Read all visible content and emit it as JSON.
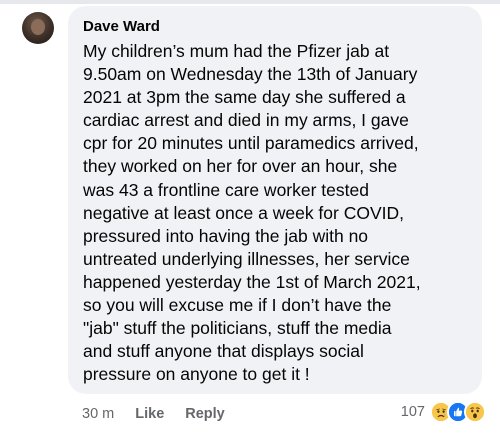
{
  "comment": {
    "author": "Dave Ward",
    "lines": [
      "My children’s mum had the Pfizer jab at",
      "9.50am on Wednesday the 13th of January",
      "2021 at 3pm the same day she suffered a",
      "cardiac arrest and died in my arms, I gave",
      "cpr for 20 minutes until paramedics arrived,",
      "they worked on her for over an hour, she",
      "was 43 a frontline care worker tested",
      "negative at least once a week for COVID,",
      "pressured into having the jab with no",
      "untreated underlying illnesses, her service",
      "happened yesterday the 1st of March 2021,",
      "so you will excuse me if I don’t have the",
      "\"jab\" stuff the politicians, stuff the media",
      "and stuff anyone that displays social",
      "pressure on anyone to get it !"
    ]
  },
  "actions": {
    "time": "30 m",
    "like_label": "Like",
    "reply_label": "Reply"
  },
  "reactions": {
    "count": "107",
    "icons": [
      "sad-reaction-icon",
      "like-reaction-icon",
      "wow-reaction-icon"
    ],
    "colors": {
      "sad": "#f7c64a",
      "like": "#1877f2",
      "wow": "#f7c64a"
    }
  }
}
